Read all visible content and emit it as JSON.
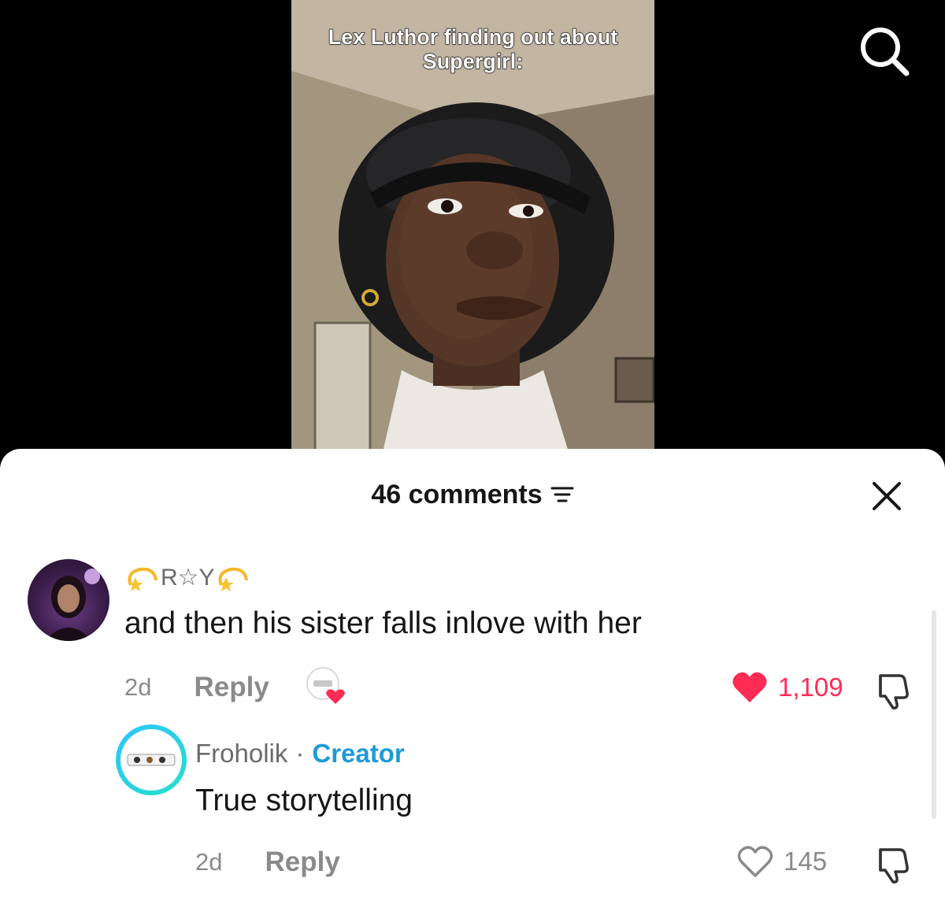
{
  "video": {
    "caption": "Lex Luthor finding out about Supergirl:"
  },
  "icons": {
    "search": "search-icon",
    "sort": "sort-icon",
    "close": "close-icon",
    "heart_filled": "heart-filled-icon",
    "heart_outline": "heart-outline-icon",
    "dislike": "thumbs-down-icon",
    "dizzy": "dizzy-star-emoji"
  },
  "comments_sheet": {
    "count_label": "46 comments",
    "comments": [
      {
        "username": "R☆Y",
        "text": "and then his sister falls inlove with her",
        "time": "2d",
        "reply_label": "Reply",
        "likes": "1,109",
        "liked": true
      },
      {
        "username": "Froholik",
        "separator": "·",
        "badge": "Creator",
        "text": "True storytelling",
        "time": "2d",
        "reply_label": "Reply",
        "likes": "145",
        "liked": false
      }
    ]
  },
  "colors": {
    "like_red": "#fe2c55",
    "creator_blue": "#1d9bd7",
    "muted_gray": "#8a8a8a"
  }
}
